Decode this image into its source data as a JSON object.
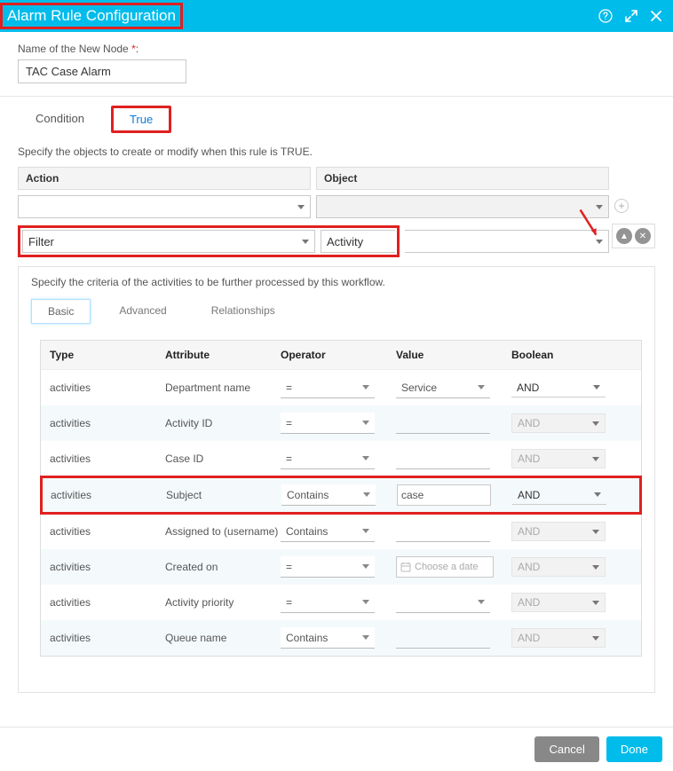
{
  "header": {
    "title": "Alarm Rule Configuration"
  },
  "name_field": {
    "label": "Name of the New Node",
    "value": "TAC Case Alarm"
  },
  "tabs": {
    "condition": "Condition",
    "true": "True"
  },
  "instruction": "Specify the objects to create or modify when this rule is TRUE.",
  "action_header": "Action",
  "object_header": "Object",
  "filter_row": {
    "action": "Filter",
    "object": "Activity"
  },
  "criteria_instruction": "Specify the criteria of the activities to be further processed by this workflow.",
  "sub_tabs": {
    "basic": "Basic",
    "advanced": "Advanced",
    "relationships": "Relationships"
  },
  "table_headers": {
    "type": "Type",
    "attribute": "Attribute",
    "operator": "Operator",
    "value": "Value",
    "boolean": "Boolean"
  },
  "rows": [
    {
      "type": "activities",
      "attribute": "Department name",
      "operator": "=",
      "value": "Service",
      "value_type": "select",
      "boolean": "AND",
      "boolean_enabled": true
    },
    {
      "type": "activities",
      "attribute": "Activity ID",
      "operator": "=",
      "value": "",
      "value_type": "input",
      "boolean": "AND",
      "boolean_enabled": false
    },
    {
      "type": "activities",
      "attribute": "Case ID",
      "operator": "=",
      "value": "",
      "value_type": "input",
      "boolean": "AND",
      "boolean_enabled": false
    },
    {
      "type": "activities",
      "attribute": "Subject",
      "operator": "Contains",
      "value": "case",
      "value_type": "input-boxed",
      "boolean": "AND",
      "boolean_enabled": true,
      "highlight": true
    },
    {
      "type": "activities",
      "attribute": "Assigned to (username)",
      "operator": "Contains",
      "value": "",
      "value_type": "input",
      "boolean": "AND",
      "boolean_enabled": false
    },
    {
      "type": "activities",
      "attribute": "Created on",
      "operator": "=",
      "value": "",
      "value_type": "date",
      "date_placeholder": "Choose a date",
      "boolean": "AND",
      "boolean_enabled": false
    },
    {
      "type": "activities",
      "attribute": "Activity priority",
      "operator": "=",
      "value": "",
      "value_type": "select-empty",
      "boolean": "AND",
      "boolean_enabled": false
    },
    {
      "type": "activities",
      "attribute": "Queue name",
      "operator": "Contains",
      "value": "",
      "value_type": "input",
      "boolean": "AND",
      "boolean_enabled": false
    }
  ],
  "footer": {
    "cancel": "Cancel",
    "done": "Done"
  }
}
